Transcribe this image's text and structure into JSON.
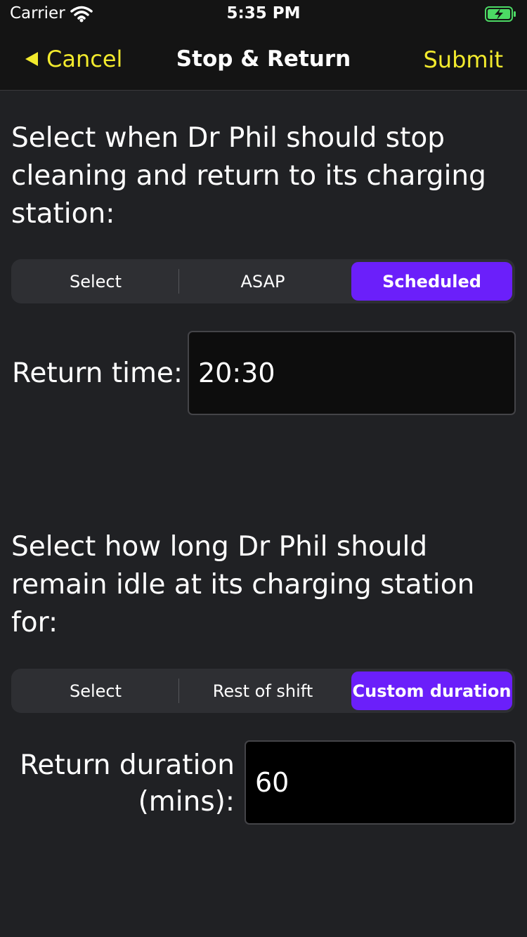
{
  "status_bar": {
    "carrier": "Carrier",
    "time": "5:35 PM",
    "icons": [
      "wifi-icon",
      "battery-charging-icon"
    ]
  },
  "nav": {
    "cancel_label": "Cancel",
    "title": "Stop & Return",
    "submit_label": "Submit",
    "accent_color": "#f2ea2d"
  },
  "return_section": {
    "prompt": "Select when Dr Phil should stop cleaning and return to its charging station:",
    "options": [
      "Select",
      "ASAP",
      "Scheduled"
    ],
    "selected": "Scheduled",
    "field_label": "Return time:",
    "field_value": "20:30"
  },
  "idle_section": {
    "prompt": "Select how long Dr Phil should remain idle at its charging station for:",
    "options": [
      "Select",
      "Rest of shift",
      "Custom duration"
    ],
    "selected": "Custom duration",
    "field_label": "Return duration (mins):",
    "field_value": "60"
  },
  "colors": {
    "background": "#202124",
    "selected_segment": "#6b1ffa"
  }
}
